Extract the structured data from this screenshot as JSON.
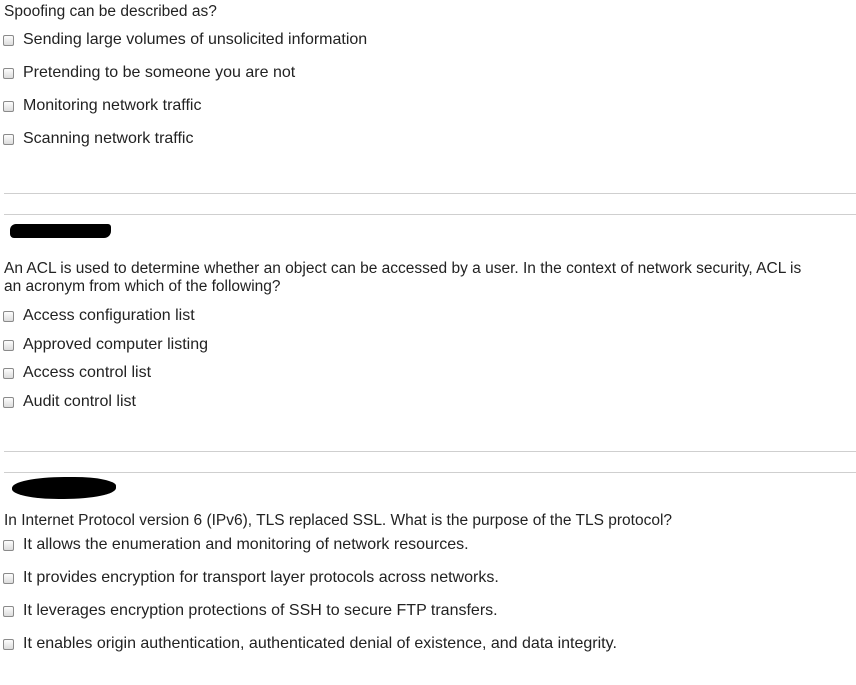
{
  "questions": [
    {
      "text": "Spoofing can be described as?",
      "options": [
        {
          "label": "Sending large volumes of unsolicited information",
          "checked": false
        },
        {
          "label": "Pretending to be someone you are not",
          "checked": false
        },
        {
          "label": "Monitoring network traffic",
          "checked": false
        },
        {
          "label": "Scanning network traffic",
          "checked": false
        }
      ]
    },
    {
      "header_redacted": true,
      "text": "An ACL is used to determine whether an object can be accessed by a user. In the context of network security, ACL is an acronym from which of the following?",
      "text_line1": "An ACL is used to determine whether an object can be accessed by a user. In the context of network security, ACL is",
      "text_line2": "an acronym from which of the following?",
      "options": [
        {
          "label": "Access configuration list",
          "checked": false
        },
        {
          "label": "Approved computer listing",
          "checked": false
        },
        {
          "label": "Access control list",
          "checked": false
        },
        {
          "label": "Audit control list",
          "checked": false
        }
      ]
    },
    {
      "header_redacted": true,
      "text": "In Internet Protocol version 6 (IPv6), TLS replaced SSL. What is the purpose of the TLS protocol?",
      "options": [
        {
          "label": "It allows the enumeration and monitoring of network resources.",
          "checked": false
        },
        {
          "label": "It provides encryption for transport layer protocols across networks.",
          "checked": false
        },
        {
          "label": "It leverages encryption protections of SSH to secure FTP transfers.",
          "checked": false
        },
        {
          "label": "It enables origin authentication, authenticated denial of existence, and data integrity.",
          "checked": false
        }
      ]
    }
  ]
}
